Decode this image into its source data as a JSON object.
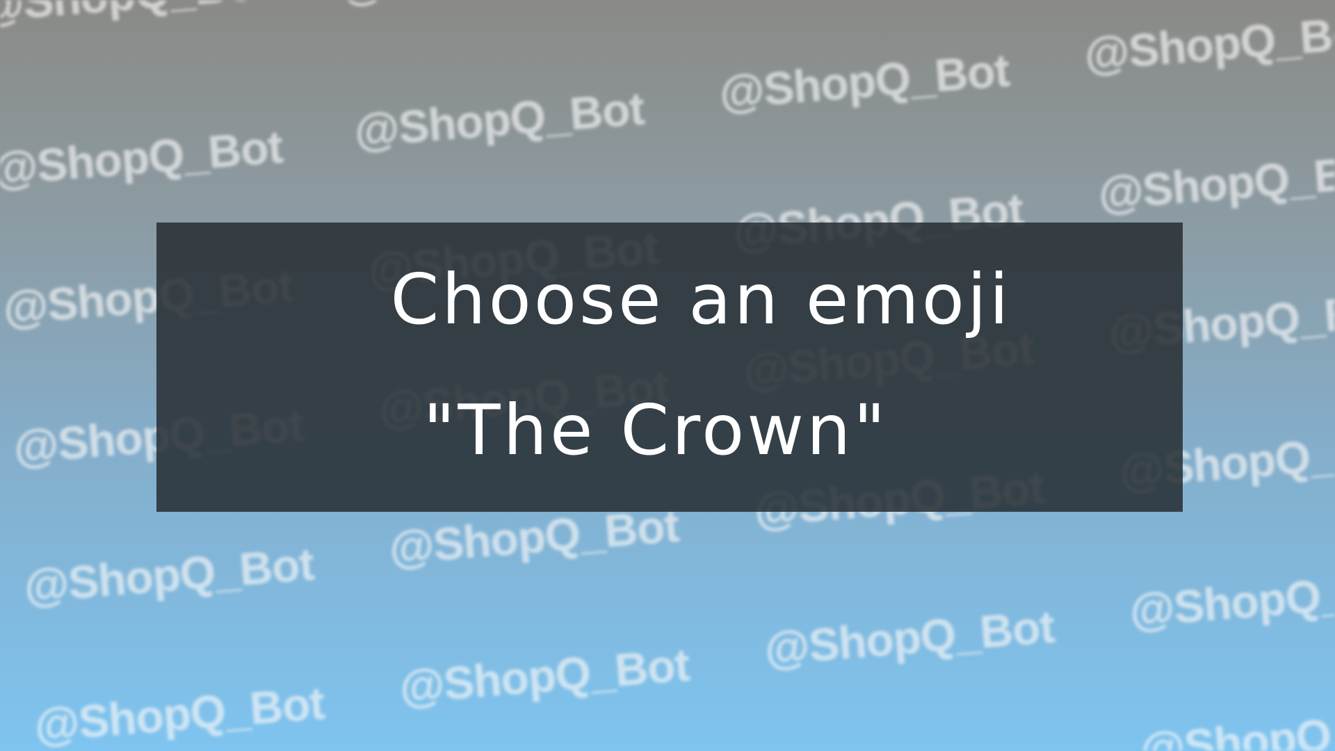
{
  "watermark": {
    "text": "@ShopQ_Bot"
  },
  "card": {
    "line1": "Choose an emoji",
    "line2": "\"The Crown\""
  },
  "colors": {
    "background_top": "#8a8a86",
    "background_bottom": "#7ec4f0",
    "panel": "#262d32",
    "text": "#ffffff"
  }
}
